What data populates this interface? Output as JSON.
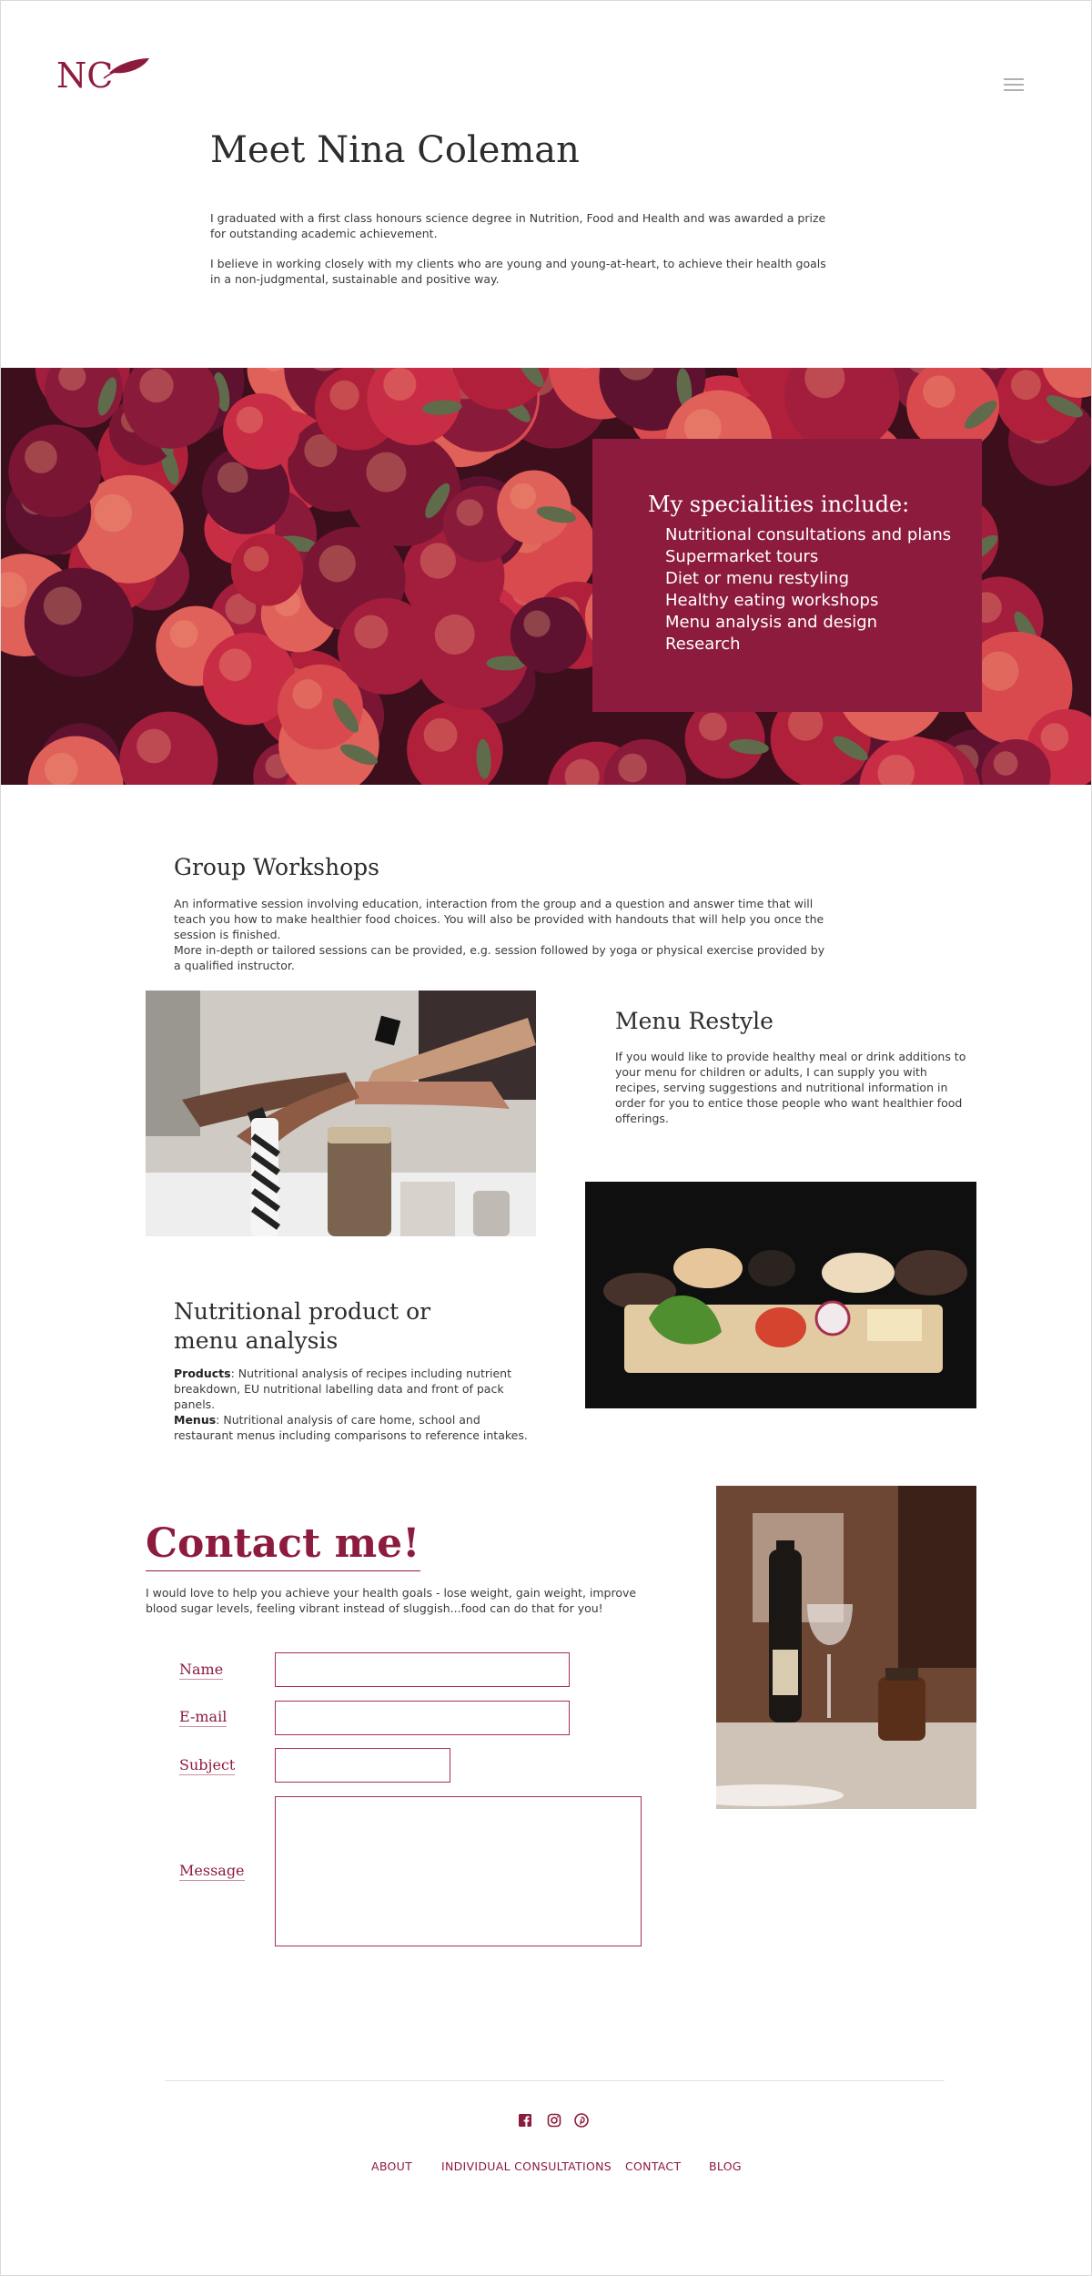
{
  "brand": {
    "logo_text": "NC",
    "accent_color": "#8d1b3d"
  },
  "header": {
    "menu_icon": "hamburger-icon"
  },
  "intro": {
    "title": "Meet Nina Coleman",
    "paragraph_1": "I graduated with a first class honours science degree in Nutrition, Food and Health and was awarded a prize for outstanding academic achievement.",
    "paragraph_2": "I believe in working closely with my clients who are young and young-at-heart, to achieve their health goals in a non-judgmental, sustainable and positive way."
  },
  "specialities": {
    "title": "My specialities include:",
    "items": [
      "Nutritional consultations and plans",
      "Supermarket tours",
      "Diet or menu restyling",
      "Healthy eating workshops",
      "Menu analysis and design",
      "Research"
    ]
  },
  "workshops": {
    "title": "Group Workshops",
    "paragraph_1": "An informative session involving education, interaction from the group and a question and answer time that will teach you how to make healthier food choices. You will also be provided with handouts that will help you once the session is finished.",
    "paragraph_2": "More in-depth or tailored sessions can be provided, e.g. session followed by yoga or physical exercise provided by a qualified instructor."
  },
  "menu_restyle": {
    "title": "Menu Restyle",
    "paragraph": "If you would like to provide healthy meal or drink additions to your menu for children or adults, I can supply you with recipes, serving suggestions and nutritional information in order for you to entice those people who want healthier food offerings."
  },
  "analysis": {
    "title_line_1": "Nutritional product or",
    "title_line_2": "menu analysis",
    "products_label": "Products",
    "products_text": ": Nutritional analysis of recipes including nutrient breakdown, EU nutritional labelling data and front of pack panels.",
    "menus_label": "Menus",
    "menus_text": ": Nutritional analysis of care home, school and restaurant menus including comparisons to reference intakes."
  },
  "contact": {
    "title": "Contact me!",
    "paragraph": "I would love to help you achieve your health goals - lose weight, gain weight, improve blood sugar levels, feeling vibrant instead of sluggish...food can do that for you!",
    "name_label": "Name",
    "email_label": "E-mail",
    "subject_label": "Subject",
    "message_label": "Message",
    "name_value": "",
    "email_value": "",
    "subject_value": "",
    "message_value": ""
  },
  "footer": {
    "social_icons": [
      "facebook-icon",
      "instagram-icon",
      "pinterest-icon"
    ],
    "nav": [
      "ABOUT",
      "INDIVIDUAL CONSULTATIONS",
      "CONTACT",
      "BLOG"
    ]
  }
}
